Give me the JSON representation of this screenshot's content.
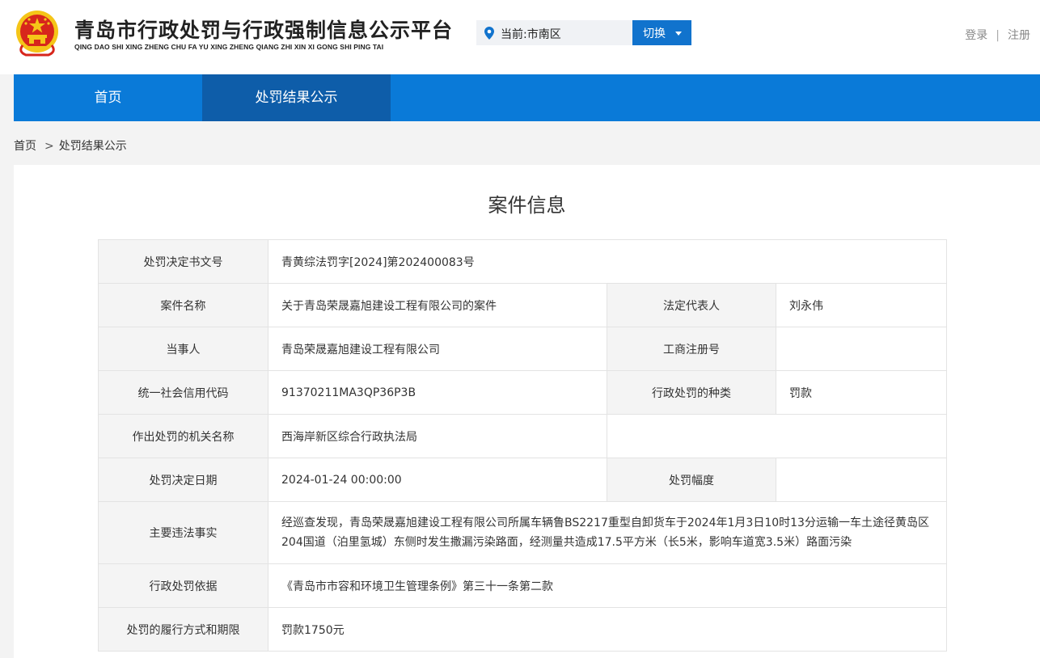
{
  "header": {
    "title": "青岛市行政处罚与行政强制信息公示平台",
    "subtitle": "QING DAO SHI XING ZHENG CHU FA YU XING ZHENG QIANG ZHI XIN XI GONG SHI PING TAI",
    "location_text": "当前:市南区",
    "switch_label": "切换",
    "login_label": "登录",
    "auth_separator": "|",
    "register_label": "注册"
  },
  "nav": {
    "items": [
      {
        "label": "首页",
        "active": false
      },
      {
        "label": "处罚结果公示",
        "active": true
      }
    ]
  },
  "breadcrumb": {
    "home": "首页",
    "separator": ">",
    "current": "处罚结果公示"
  },
  "card": {
    "title": "案件信息",
    "fields": {
      "decision_no_label": "处罚决定书文号",
      "decision_no": "青黄综法罚字[2024]第202400083号",
      "case_name_label": "案件名称",
      "case_name": "关于青岛荣晟嘉旭建设工程有限公司的案件",
      "legal_rep_label": "法定代表人",
      "legal_rep": "刘永伟",
      "party_label": "当事人",
      "party": "青岛荣晟嘉旭建设工程有限公司",
      "biz_reg_label": "工商注册号",
      "biz_reg": "",
      "credit_code_label": "统一社会信用代码",
      "credit_code": "91370211MA3QP36P3B",
      "penalty_type_label": "行政处罚的种类",
      "penalty_type": "罚款",
      "authority_label": "作出处罚的机关名称",
      "authority": "西海岸新区综合行政执法局",
      "decision_date_label": "处罚决定日期",
      "decision_date": "2024-01-24 00:00:00",
      "penalty_range_label": "处罚幅度",
      "penalty_range": "",
      "facts_label": "主要违法事实",
      "facts": "经巡查发现，青岛荣晟嘉旭建设工程有限公司所属车辆鲁BS2217重型自卸货车于2024年1月3日10时13分运输一车土途径黄岛区204国道（泊里氢城）东侧时发生撒漏污染路面，经测量共造成17.5平方米（长5米，影响车道宽3.5米）路面污染",
      "basis_label": "行政处罚依据",
      "basis": "《青岛市市容和环境卫生管理条例》第三十一条第二款",
      "execution_label": "处罚的履行方式和期限",
      "execution": "罚款1750元"
    }
  },
  "colors": {
    "primary_blue": "#0a7ad8",
    "nav_active": "#0e5da9",
    "switch_button": "#1173cd",
    "emblem_red": "#d7261c",
    "emblem_gold": "#f5c518"
  },
  "icons": {
    "emblem": "national-emblem-icon",
    "location": "location-pin-icon",
    "dropdown": "caret-down-icon"
  }
}
